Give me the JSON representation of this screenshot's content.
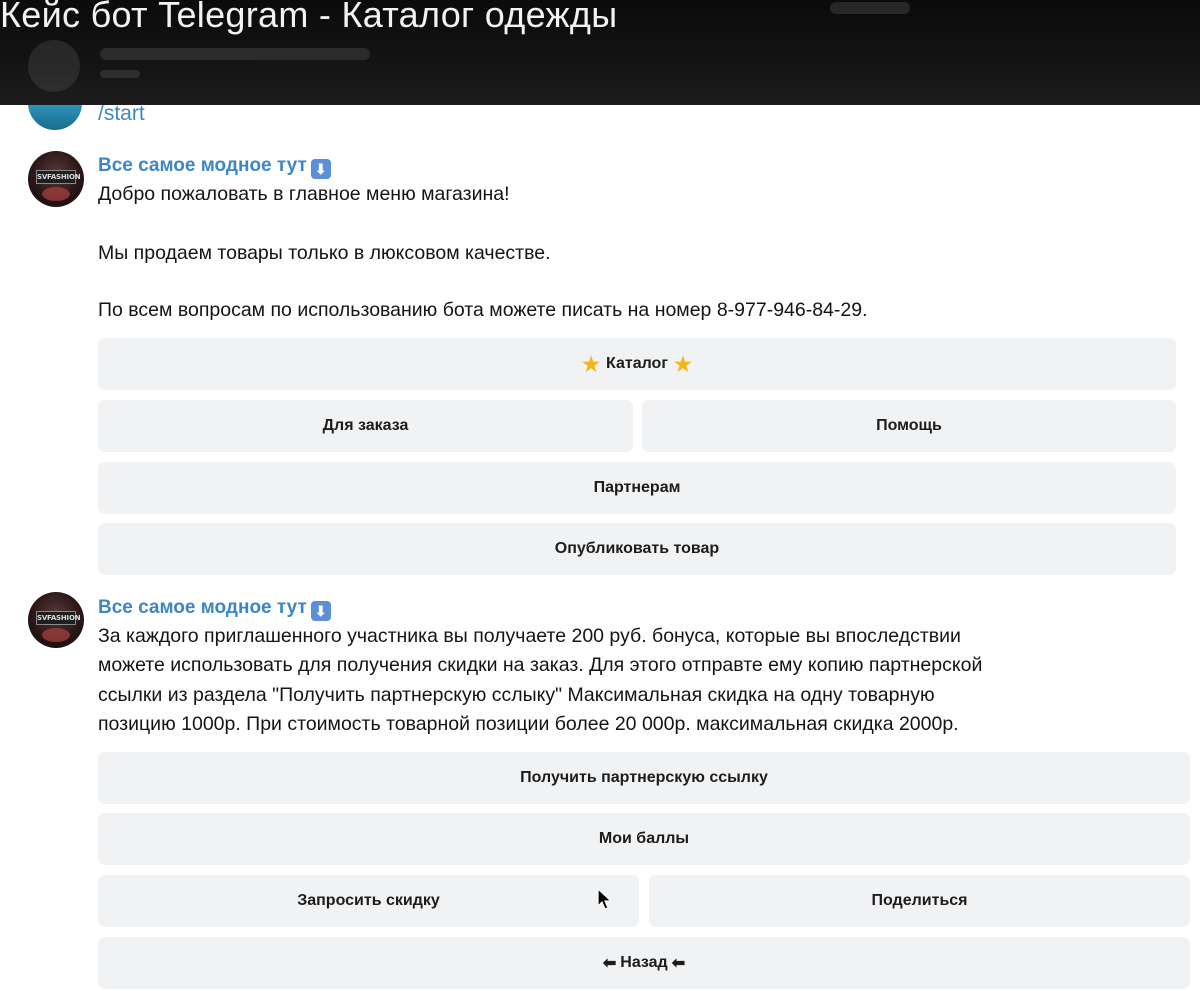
{
  "video_title": "Кейс бот Telegram - Каталог одежды",
  "user_command": "/start",
  "messages": [
    {
      "sender": "Все самое модное тут",
      "avatar_badge": "SVFASHION",
      "lines": [
        "Добро пожаловать в главное меню магазина!",
        "Мы продаем товары только в люксовом качестве.",
        "По всем вопросам по использованию бота можете писать на номер 8-977-946-84-29."
      ],
      "buttons": {
        "catalog": "Каталог",
        "order": "Для заказа",
        "help": "Помощь",
        "partners": "Партнерам",
        "publish": "Опубликовать товар"
      }
    },
    {
      "sender": "Все самое модное тут",
      "avatar_badge": "SVFASHION",
      "lines": [
        "За каждого приглашенного участника вы получаете 200 руб. бонуса, которые вы впоследствии",
        "можете использовать для получения скидки на заказ. Для этого отправте ему копию партнерской",
        "ссылки из раздела \"Получить партнерскую сслыку\" Максимальная скидка на одну товарную",
        "позицию 1000р. При стоимость товарной позиции более 20 000р. максимальная скидка 2000р."
      ],
      "buttons": {
        "get_link": "Получить партнерскую ссылку",
        "my_points": "Мои баллы",
        "request_discount": "Запросить скидку",
        "share": "Поделиться",
        "back": "Назад"
      }
    }
  ],
  "icons": {
    "star": "★",
    "down_arrow": "⬇",
    "left_arrow": "⬅"
  },
  "colors": {
    "link_blue": "#3d86c6",
    "button_bg": "#f1f2f4",
    "star": "#f3b51c",
    "arrow_badge": "#5b8fd8"
  }
}
